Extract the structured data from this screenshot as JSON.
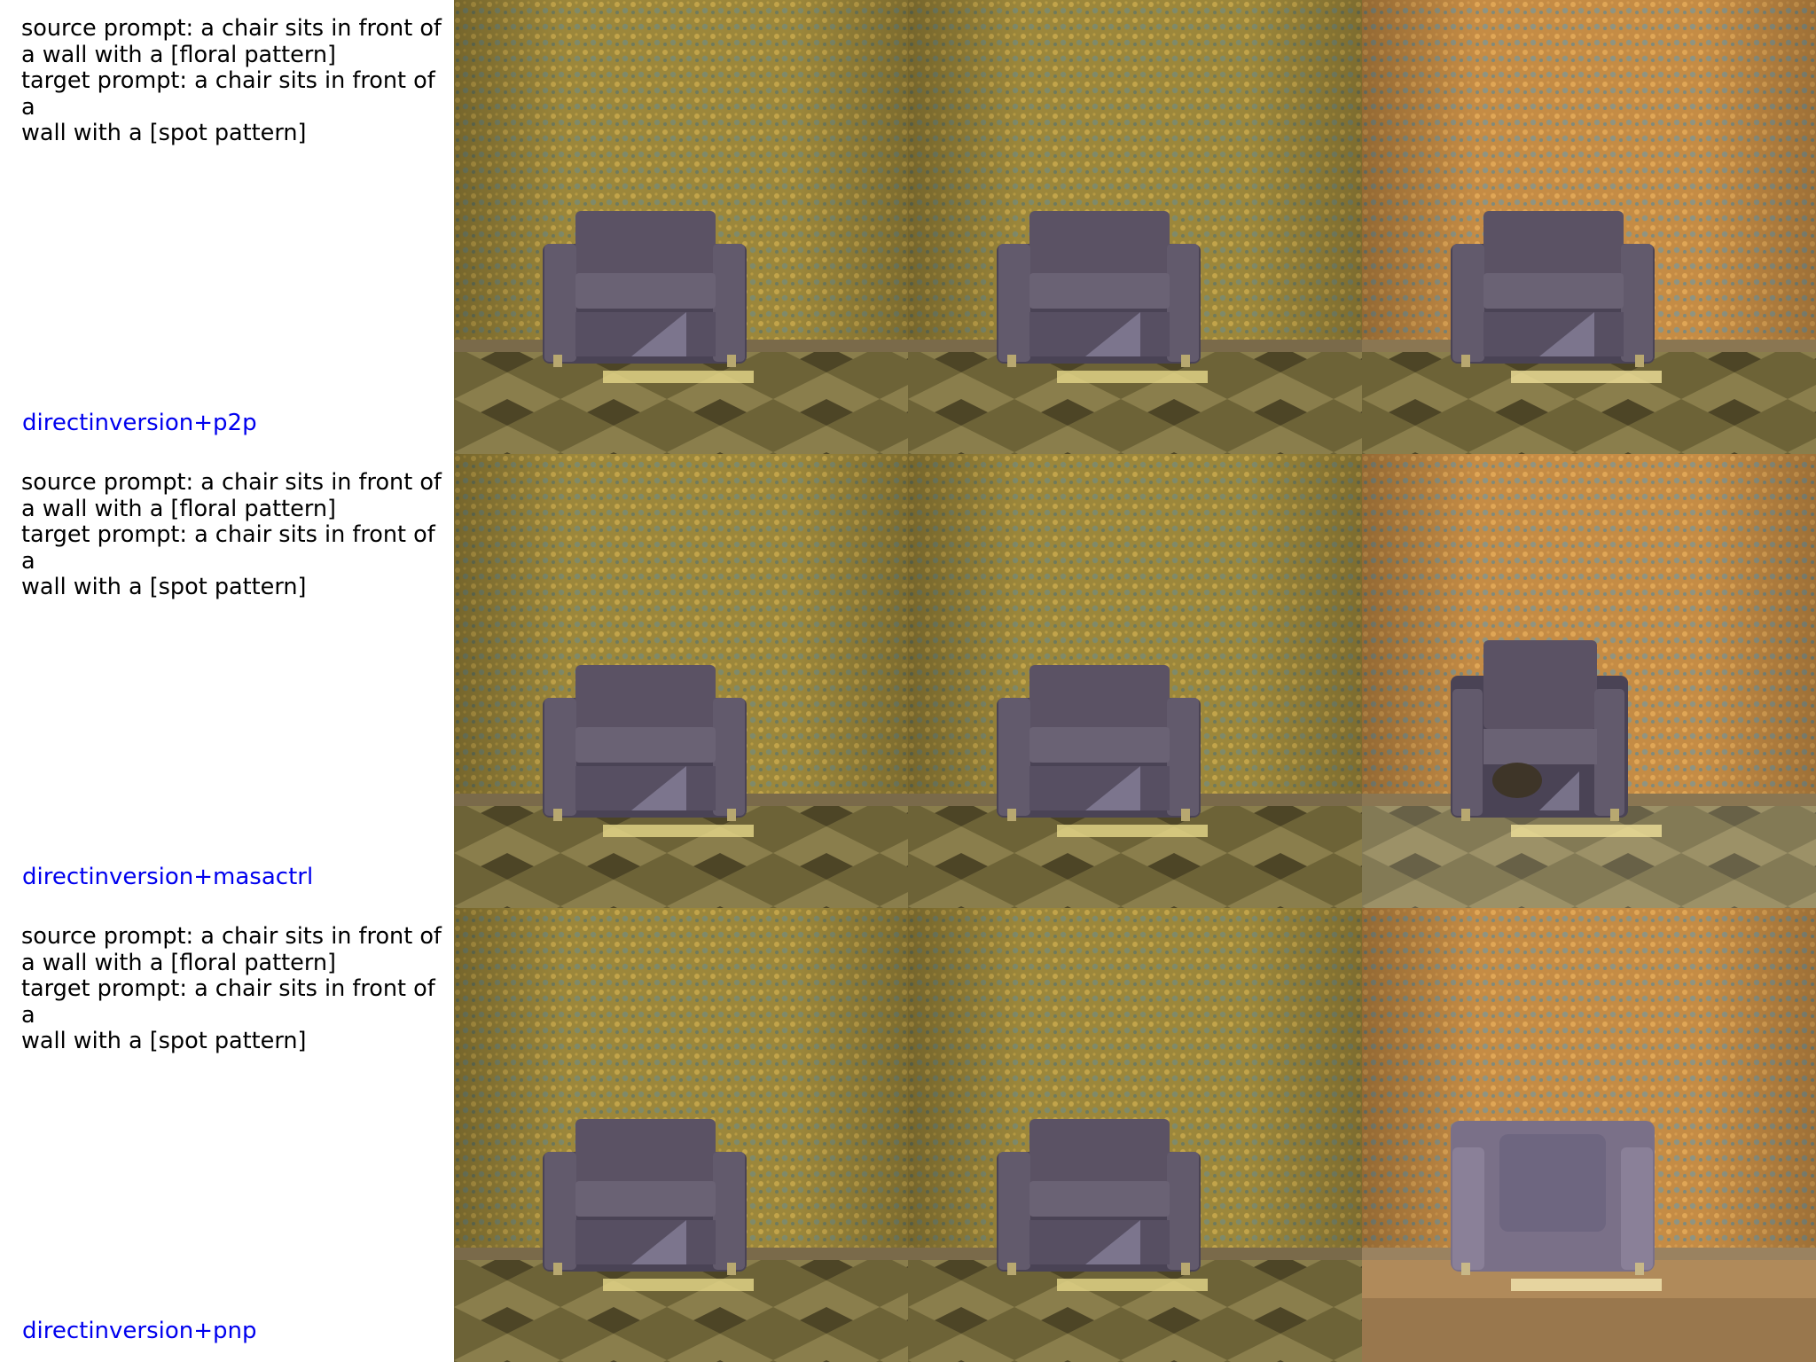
{
  "rows": [
    {
      "prompt": "source prompt: a chair sits in front of\na wall with a [floral pattern]\ntarget prompt: a chair sits in front of a\nwall with a [spot pattern]",
      "method": "directinversion+p2p"
    },
    {
      "prompt": "source prompt: a chair sits in front of\na wall with a [floral pattern]\ntarget prompt: a chair sits in front of a\nwall with a [spot pattern]",
      "method": "directinversion+masactrl"
    },
    {
      "prompt": "source prompt: a chair sits in front of\na wall with a [floral pattern]\ntarget prompt: a chair sits in front of a\nwall with a [spot pattern]",
      "method": "directinversion+pnp"
    }
  ],
  "colors": {
    "label_text": "#000000",
    "method_text": "#0000ee",
    "wall_original": "#a08a3c",
    "wall_edited": "#c7904a",
    "chair": "#5b5264",
    "floor": "#6e6438"
  }
}
